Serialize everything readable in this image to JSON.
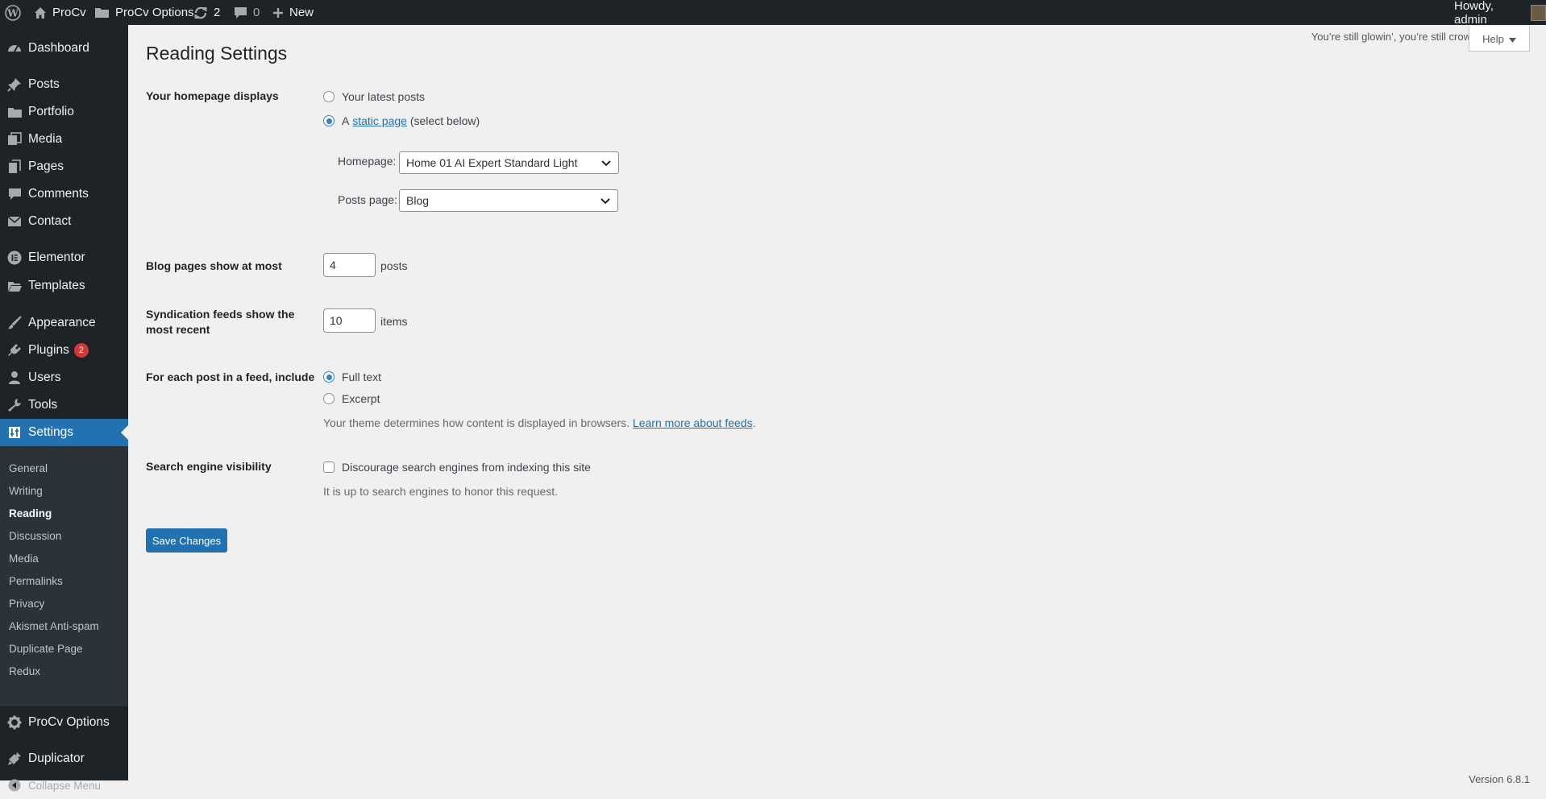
{
  "admin_bar": {
    "site_name": "ProCv",
    "options_label": "ProCv Options",
    "updates_count": "2",
    "comments_count": "0",
    "new_label": "New",
    "howdy": "Howdy, admin"
  },
  "sidebar": {
    "items": [
      {
        "label": "Dashboard",
        "icon": "dashboard-icon"
      },
      {
        "label": "Posts",
        "icon": "pin-icon"
      },
      {
        "label": "Portfolio",
        "icon": "folder-icon"
      },
      {
        "label": "Media",
        "icon": "media-icon"
      },
      {
        "label": "Pages",
        "icon": "pages-icon"
      },
      {
        "label": "Comments",
        "icon": "comment-icon"
      },
      {
        "label": "Contact",
        "icon": "mail-icon"
      },
      {
        "label": "Elementor",
        "icon": "elementor-icon"
      },
      {
        "label": "Templates",
        "icon": "folder-open-icon"
      },
      {
        "label": "Appearance",
        "icon": "brush-icon"
      },
      {
        "label": "Plugins",
        "icon": "plug-icon",
        "badge": "2"
      },
      {
        "label": "Users",
        "icon": "user-icon"
      },
      {
        "label": "Tools",
        "icon": "wrench-icon"
      },
      {
        "label": "Settings",
        "icon": "settings-icon"
      },
      {
        "label": "ProCv Options",
        "icon": "gear-icon"
      },
      {
        "label": "Duplicator",
        "icon": "duplicator-icon"
      },
      {
        "label": "Collapse Menu",
        "icon": "collapse-icon"
      }
    ],
    "submenu": [
      "General",
      "Writing",
      "Reading",
      "Discussion",
      "Media",
      "Permalinks",
      "Privacy",
      "Akismet Anti-spam",
      "Duplicate Page",
      "Redux"
    ],
    "current_sub": "Reading"
  },
  "header": {
    "title": "Reading Settings",
    "dolly": "You’re still glowin’, you’re still crowin’",
    "help": "Help"
  },
  "form": {
    "homepage_displays": {
      "label": "Your homepage displays",
      "opt_latest": "Your latest posts",
      "opt_static_pre": "A",
      "opt_static_link": "static page",
      "opt_static_post": "(select below)",
      "selected": "static"
    },
    "homepage_select": {
      "label": "Homepage:",
      "value": "Home 01 AI Expert Standard Light"
    },
    "posts_page_select": {
      "label": "Posts page:",
      "value": "Blog"
    },
    "blog_pages": {
      "label": "Blog pages show at most",
      "value": "4",
      "unit": "posts"
    },
    "syndication": {
      "label": "Syndication feeds show the most recent",
      "value": "10",
      "unit": "items"
    },
    "feed_include": {
      "label": "For each post in a feed, include",
      "opt_full": "Full text",
      "opt_excerpt": "Excerpt",
      "selected": "full",
      "desc_pre": "Your theme determines how content is displayed in browsers.",
      "desc_link": "Learn more about feeds",
      "desc_post": "."
    },
    "search_visibility": {
      "label": "Search engine visibility",
      "checkbox_label": "Discourage search engines from indexing this site",
      "checked": false,
      "desc": "It is up to search engines to honor this request."
    },
    "save_label": "Save Changes"
  },
  "footer": {
    "version": "Version 6.8.1"
  },
  "colors": {
    "accent": "#2271b1",
    "sidebar_bg": "#1d2327",
    "submenu_bg": "#2c3338",
    "badge": "#d63638"
  }
}
